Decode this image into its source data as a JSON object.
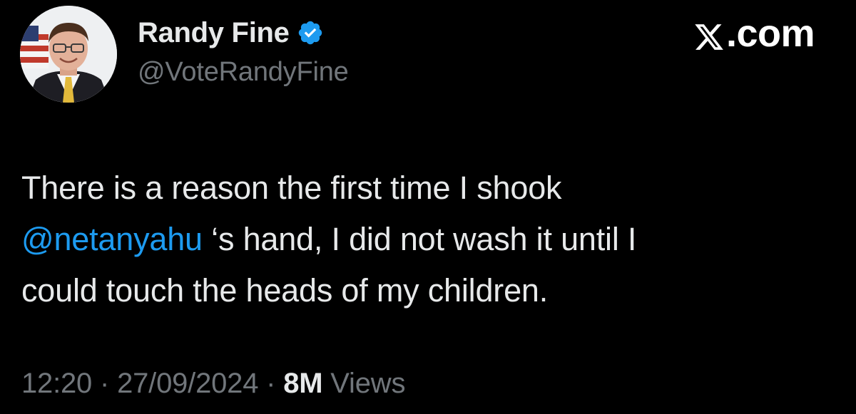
{
  "user": {
    "display_name": "Randy Fine",
    "handle": "@VoteRandyFine",
    "verified": true,
    "avatar_icon": "profile-photo",
    "verified_icon": "verified-badge-icon",
    "verified_color": "#1d9bf0"
  },
  "brand": {
    "icon": "x-logo-icon",
    "suffix": ".com"
  },
  "tweet": {
    "line1": "There is a reason the first time I shook",
    "mention": "@netanyahu",
    "line2_rest": " ‘s hand, I did not wash it until I",
    "line3": "could touch the heads of my children."
  },
  "meta": {
    "time": "12:20",
    "separator1": " · ",
    "date": "27/09/2024",
    "separator2": " · ",
    "views_count": "8M",
    "views_label": " Views"
  },
  "colors": {
    "background": "#000000",
    "text": "#e7e9ea",
    "secondary": "#71767b",
    "link": "#1d9bf0"
  }
}
